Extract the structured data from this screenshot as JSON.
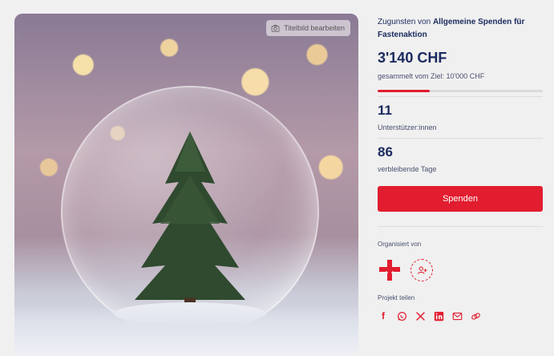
{
  "hero": {
    "edit_cover_label": "Titelbild bearbeiten"
  },
  "campaign": {
    "beneficiary_prefix": "Zugunsten von ",
    "beneficiary_name": "Allgemeine Spenden für Fastenaktion",
    "amount_raised": "3'140 CHF",
    "goal_text": "gesammelt vom Ziel: 10'000 CHF",
    "progress_fraction": 0.314,
    "supporters_count": "11",
    "supporters_label": "Unterstützer:innen",
    "days_left": "86",
    "days_left_label": "verbleibende Tage",
    "donate_label": "Spenden",
    "organized_by_label": "Organisiert von",
    "share_label": "Projekt teilen"
  },
  "colors": {
    "accent": "#e11d2f",
    "text": "#1a2a5e"
  },
  "share_icons": [
    "facebook-icon",
    "whatsapp-icon",
    "x-icon",
    "linkedin-icon",
    "email-icon",
    "link-icon"
  ]
}
